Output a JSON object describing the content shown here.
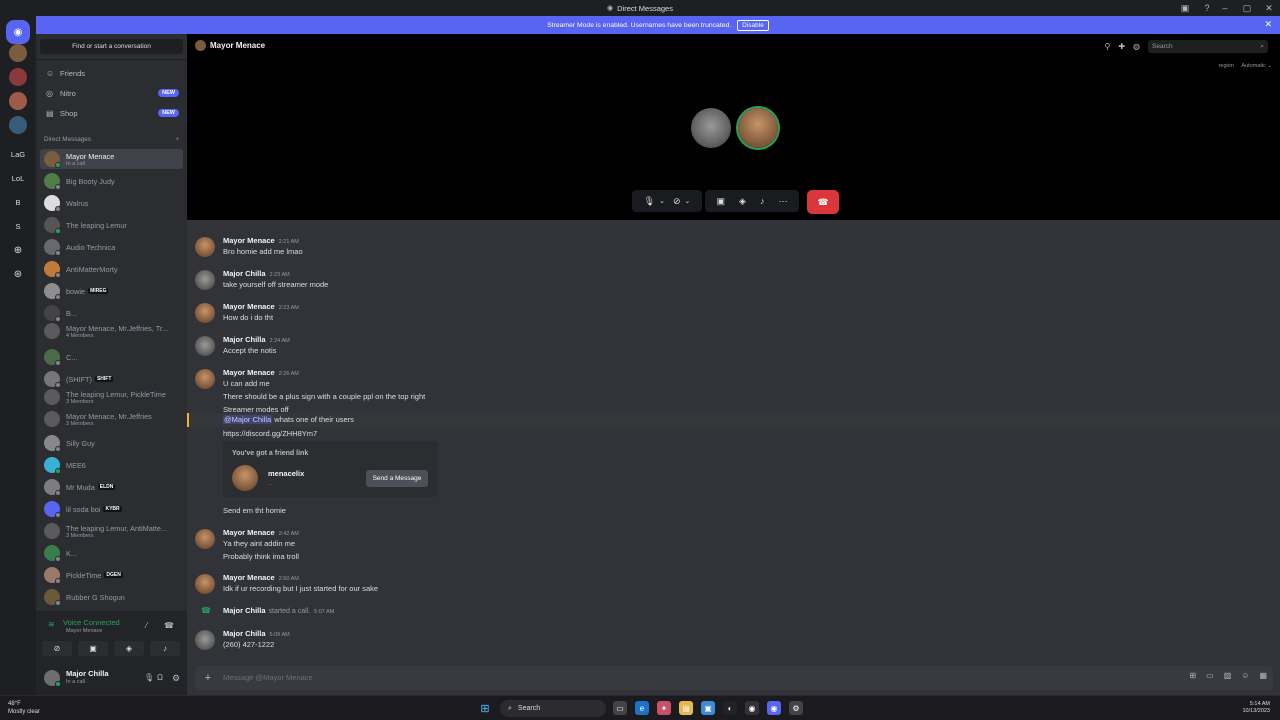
{
  "titlebar": {
    "title": "Direct Messages"
  },
  "banner": {
    "text": "Streamer Mode is enabled. Usernames have been truncated.",
    "disable_label": "Disable"
  },
  "rail": {
    "servers": [
      "LaG",
      "LoL",
      "B",
      "S"
    ]
  },
  "sidebar": {
    "find_label": "Find or start a conversation",
    "nav": [
      {
        "label": "Friends",
        "icon": "friends-icon"
      },
      {
        "label": "Nitro",
        "icon": "nitro-icon",
        "badge": "NEW"
      },
      {
        "label": "Shop",
        "icon": "shop-icon",
        "badge": "NEW"
      }
    ],
    "dm_header": "Direct Messages",
    "dms": [
      {
        "name": "Mayor Menace",
        "sub": "In a call",
        "color": "#7a5c3e",
        "status": "#23a55a"
      },
      {
        "name": "Big Booty Judy",
        "sub": "",
        "color": "#4f7d4a",
        "status": "#80848e"
      },
      {
        "name": "Walrus",
        "sub": "",
        "color": "#dddddd",
        "status": "#80848e"
      },
      {
        "name": "The leaping Lemur",
        "sub": "",
        "color": "#555555",
        "status": "#23a55a"
      },
      {
        "name": "Audio Technica",
        "sub": "",
        "color": "#666a70",
        "status": "#80848e"
      },
      {
        "name": "AntiMatterMorty",
        "sub": "",
        "color": "#c07a3a",
        "status": "#80848e"
      },
      {
        "name": "bowie",
        "sub": "",
        "tag": "MIREG",
        "color": "#8e8e8e",
        "status": "#80848e"
      },
      {
        "name": "B...",
        "sub": "",
        "color": "#444444",
        "status": "#80848e"
      },
      {
        "name": "Mayor Menace, Mr.Jeffries, Tr...",
        "sub": "4 Members",
        "color": "#5a5a5a",
        "status": ""
      },
      {
        "name": "C...",
        "sub": "",
        "color": "#4a6a4a",
        "status": "#80848e"
      },
      {
        "name": "(SHIFT)",
        "sub": "",
        "tag": "SHIFT",
        "color": "#777777",
        "status": "#80848e"
      },
      {
        "name": "The leaping Lemur, PickleTime",
        "sub": "3 Members",
        "color": "#5a5a5a",
        "status": ""
      },
      {
        "name": "Mayor Menace, Mr.Jeffries",
        "sub": "3 Members",
        "color": "#5a5a5a",
        "status": ""
      },
      {
        "name": "Silly Guy",
        "sub": "",
        "color": "#888888",
        "status": "#80848e"
      },
      {
        "name": "MEE6",
        "sub": "",
        "color": "#3ab0d6",
        "status": "#23a55a"
      },
      {
        "name": "Mr Muda",
        "sub": "",
        "tag": "ELDN",
        "color": "#7d7d7d",
        "status": "#80848e"
      },
      {
        "name": "lil soda boi",
        "sub": "",
        "tag": "KYBR",
        "color": "#5865f2",
        "status": "#80848e"
      },
      {
        "name": "The leaping Lemur, AntiMatte...",
        "sub": "3 Members",
        "color": "#5a5a5a",
        "status": ""
      },
      {
        "name": "K...",
        "sub": "",
        "color": "#3b7d4a",
        "status": "#80848e"
      },
      {
        "name": "PickleTime",
        "sub": "",
        "tag": "DGEN",
        "color": "#9a7a6a",
        "status": "#80848e"
      },
      {
        "name": "Rubber G Shogun",
        "sub": "",
        "color": "#6a5a3a",
        "status": "#80848e"
      }
    ],
    "voice": {
      "status": "Voice Connected",
      "channel": "Mayor Menace"
    },
    "user": {
      "name": "Major Chilla",
      "status": "In a call"
    }
  },
  "call": {
    "channel_name": "Mayor Menace",
    "search_placeholder": "Search",
    "region": "region",
    "quality": "Automatic"
  },
  "messages": [
    {
      "author": "Mayor Menace",
      "time": "2:21 AM",
      "lines": [
        "Bro homie add me lmao"
      ],
      "avatar": "#7a5c3e"
    },
    {
      "author": "Major Chilla",
      "time": "2:23 AM",
      "lines": [
        "take yourself off streamer mode"
      ],
      "avatar": "#6e6e6e"
    },
    {
      "author": "Mayor Menace",
      "time": "2:23 AM",
      "lines": [
        "How do i do tht"
      ],
      "avatar": "#7a5c3e"
    },
    {
      "author": "Major Chilla",
      "time": "2:24 AM",
      "lines": [
        "Accept the notis"
      ],
      "avatar": "#6e6e6e"
    },
    {
      "author": "Mayor Menace",
      "time": "2:26 AM",
      "lines": [
        "U can add me",
        "There should be a plus sign with a couple ppl on the top right",
        "Streamer modes off"
      ],
      "avatar": "#7a5c3e"
    },
    {
      "mention": "@Major Chilla",
      "mention_rest": " whats one of their users",
      "link": "https://discord.gg/ZHH8Ym7"
    },
    {
      "invite_title": "You've got a friend link",
      "invite_name": "menacelix",
      "invite_sub": "...",
      "invite_button": "Send a Message"
    },
    {
      "line_only": "Send em tht homie"
    },
    {
      "author": "Mayor Menace",
      "time": "2:42 AM",
      "lines": [
        "Ya they aint addin me",
        "Probably think ima troll"
      ],
      "avatar": "#7a5c3e"
    },
    {
      "author": "Mayor Menace",
      "time": "2:50 AM",
      "lines": [
        "Idk if ur recording but I just started for our sake"
      ],
      "avatar": "#7a5c3e"
    },
    {
      "author": "Major Chilla",
      "system": "started a call.",
      "time": "5:07 AM"
    },
    {
      "author": "Major Chilla",
      "time": "5:09 AM",
      "lines": [
        "(260) 427-1222"
      ],
      "avatar": "#6e6e6e"
    }
  ],
  "composer": {
    "placeholder": "Message @Mayor Menace"
  },
  "taskbar": {
    "temp": "48°F",
    "weather": "Mostly clear",
    "search": "Search",
    "time": "5:14 AM",
    "date": "10/13/2023"
  }
}
